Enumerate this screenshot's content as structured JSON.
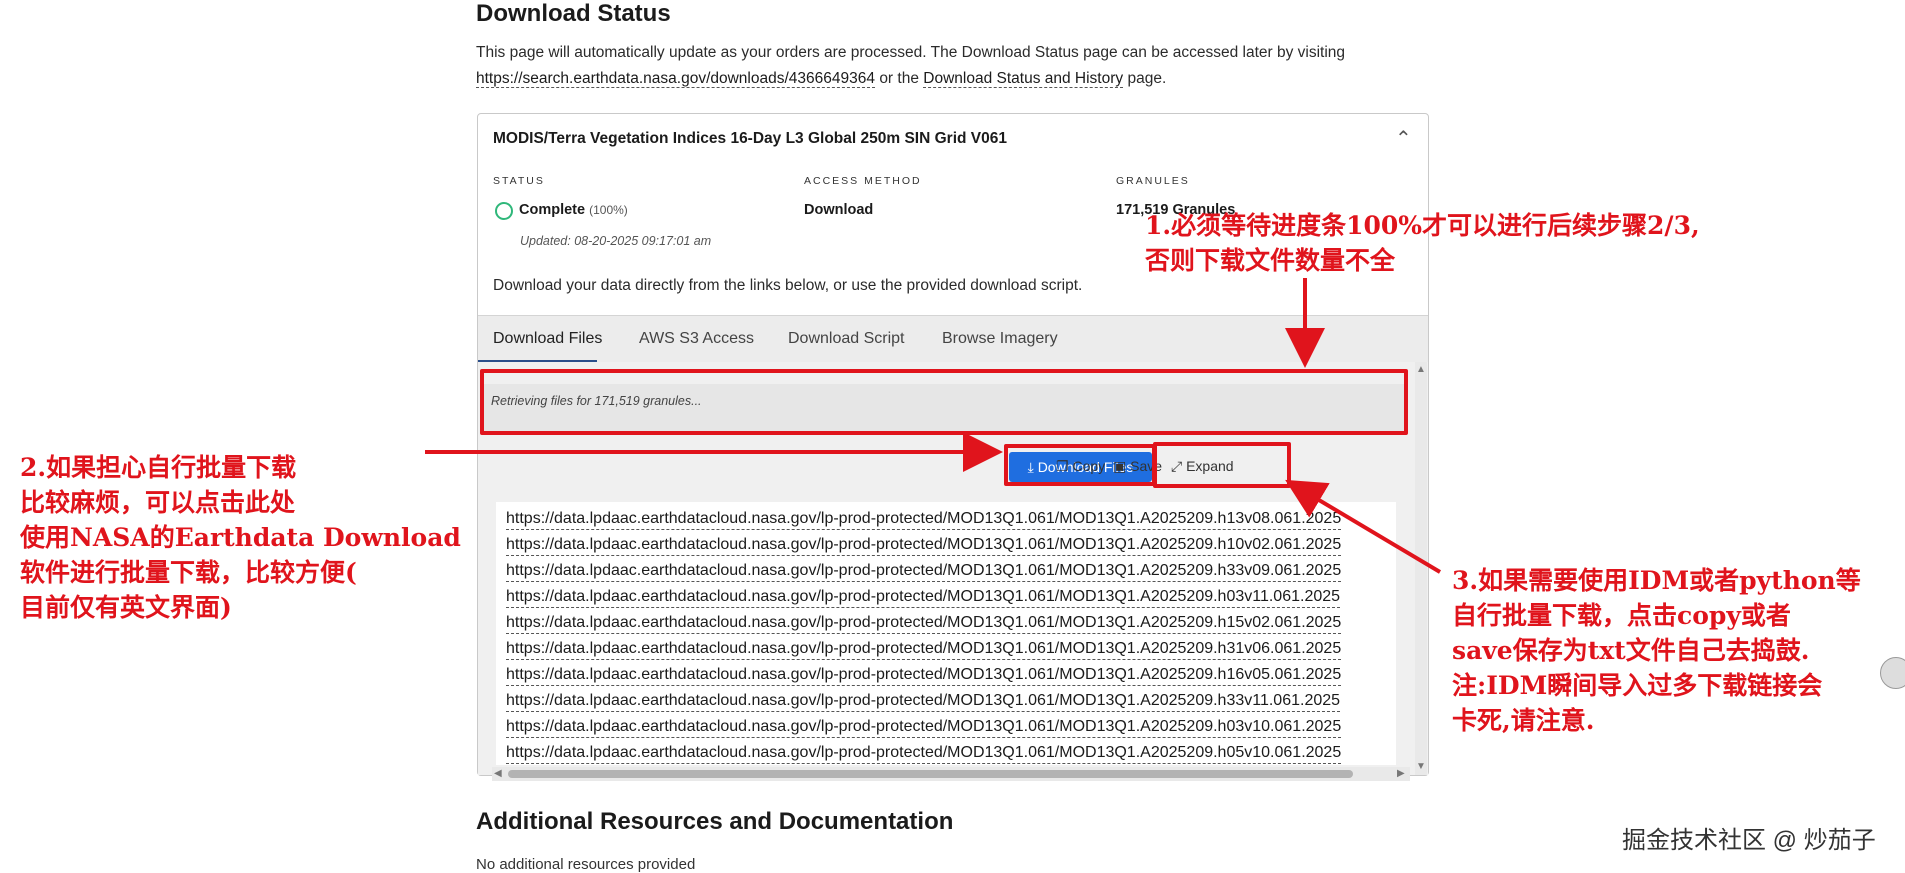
{
  "header": {
    "title": "Download Status",
    "intro_text": "This page will automatically update as your orders are processed. The Download Status page can be accessed later by visiting",
    "url_link": "https://search.earthdata.nasa.gov/downloads/4366649364",
    "or_the": "or the",
    "history_link": "Download Status and History",
    "page_suffix": "page."
  },
  "dataset": {
    "title": "MODIS/Terra Vegetation Indices 16-Day L3 Global 250m SIN Grid V061",
    "status_header": "STATUS",
    "status_value": "Complete",
    "status_pct": "(100%)",
    "updated": "Updated: 08-20-2025 09:17:01 am",
    "access_header": "ACCESS METHOD",
    "access_value": "Download",
    "granules_header": "GRANULES",
    "granules_value": "171,519 Granules",
    "description": "Download your data directly from the links below, or use the provided download script."
  },
  "tabs": [
    "Download Files",
    "AWS S3 Access",
    "Download Script",
    "Browse Imagery"
  ],
  "retrieving": "Retrieving files for 171,519 granules...",
  "toolbar": {
    "download_label": "Download Files",
    "copy_label": "Copy",
    "save_label": "Save",
    "expand_label": "Expand"
  },
  "urls": [
    "https://data.lpdaac.earthdatacloud.nasa.gov/lp-prod-protected/MOD13Q1.061/MOD13Q1.A2025209.h13v08.061.2025",
    "https://data.lpdaac.earthdatacloud.nasa.gov/lp-prod-protected/MOD13Q1.061/MOD13Q1.A2025209.h10v02.061.2025",
    "https://data.lpdaac.earthdatacloud.nasa.gov/lp-prod-protected/MOD13Q1.061/MOD13Q1.A2025209.h33v09.061.2025",
    "https://data.lpdaac.earthdatacloud.nasa.gov/lp-prod-protected/MOD13Q1.061/MOD13Q1.A2025209.h03v11.061.2025",
    "https://data.lpdaac.earthdatacloud.nasa.gov/lp-prod-protected/MOD13Q1.061/MOD13Q1.A2025209.h15v02.061.2025",
    "https://data.lpdaac.earthdatacloud.nasa.gov/lp-prod-protected/MOD13Q1.061/MOD13Q1.A2025209.h31v06.061.2025",
    "https://data.lpdaac.earthdatacloud.nasa.gov/lp-prod-protected/MOD13Q1.061/MOD13Q1.A2025209.h16v05.061.2025",
    "https://data.lpdaac.earthdatacloud.nasa.gov/lp-prod-protected/MOD13Q1.061/MOD13Q1.A2025209.h33v11.061.2025",
    "https://data.lpdaac.earthdatacloud.nasa.gov/lp-prod-protected/MOD13Q1.061/MOD13Q1.A2025209.h03v10.061.2025",
    "https://data.lpdaac.earthdatacloud.nasa.gov/lp-prod-protected/MOD13Q1.061/MOD13Q1.A2025209.h05v10.061.2025"
  ],
  "resources": {
    "title": "Additional Resources and Documentation",
    "text": "No additional resources provided"
  },
  "annotations": {
    "note1": [
      "1.必须等待进度条100%才可以进行后续步骤2/3,",
      "否则下载文件数量不全"
    ],
    "note2": [
      "2.如果担心自行批量下载",
      "比较麻烦，可以点击此处",
      "使用NASA的Earthdata Download",
      "软件进行批量下载，比较方便(",
      "目前仅有英文界面)"
    ],
    "note3": [
      "3.如果需要使用IDM或者python等",
      "自行批量下载，点击copy或者",
      "save保存为txt文件自己去捣鼓.",
      "注:IDM瞬间导入过多下载链接会",
      "卡死,请注意."
    ]
  },
  "watermark": "掘金技术社区 @ 炒茄子",
  "colors": {
    "annotation_red": "#e0141c",
    "primary_blue": "#1f6ee0",
    "status_green": "#2fb77a"
  }
}
